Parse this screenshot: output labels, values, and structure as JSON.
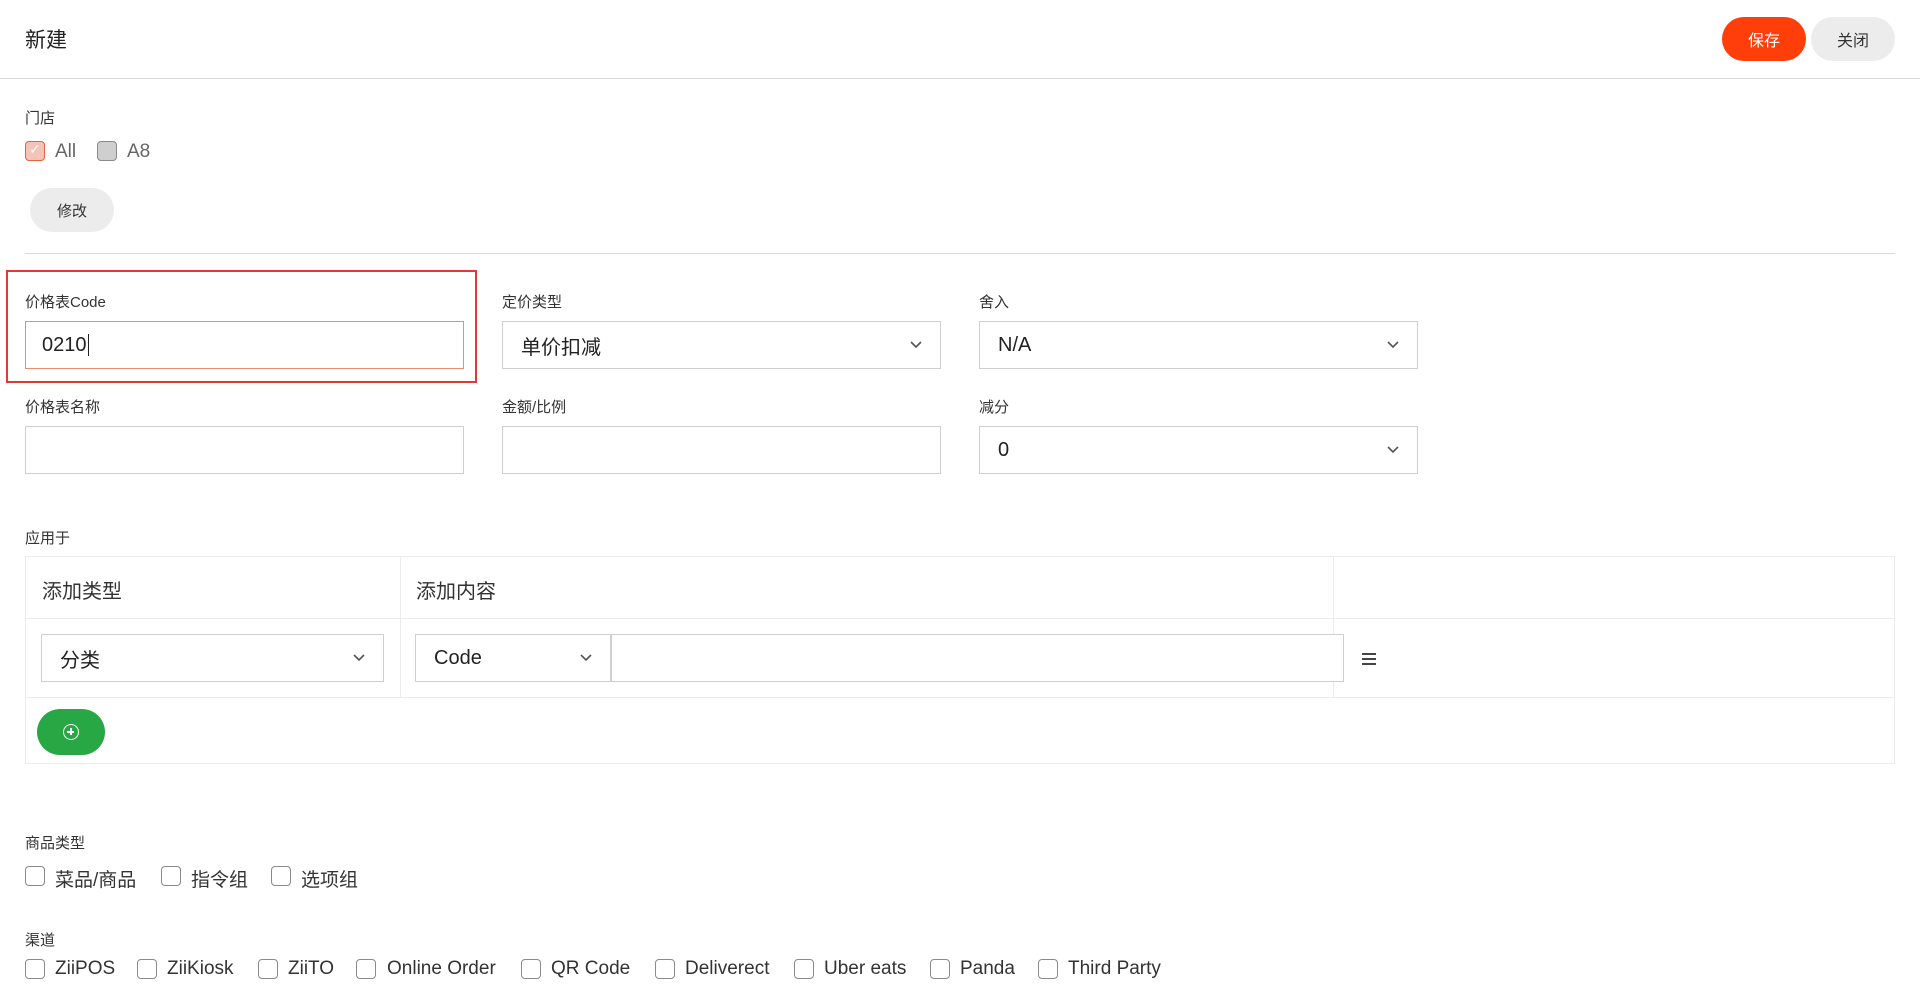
{
  "header": {
    "title": "新建",
    "save_label": "保存",
    "close_label": "关闭"
  },
  "store": {
    "label": "门店",
    "options": [
      {
        "label": "All",
        "checked": true
      },
      {
        "label": "A8",
        "checked": false
      }
    ],
    "modify_label": "修改"
  },
  "form": {
    "code_label": "价格表Code",
    "code_value": "0210",
    "pricing_type_label": "定价类型",
    "pricing_type_value": "单价扣减",
    "rounding_label": "舍入",
    "rounding_value": "N/A",
    "name_label": "价格表名称",
    "name_value": "",
    "amount_label": "金额/比例",
    "amount_value": "",
    "reduce_label": "减分",
    "reduce_value": "0"
  },
  "apply": {
    "label": "应用于",
    "col_type": "添加类型",
    "col_content": "添加内容",
    "row": {
      "type_value": "分类",
      "content_mode": "Code",
      "content_value": ""
    }
  },
  "product_type": {
    "label": "商品类型",
    "options": [
      "菜品/商品",
      "指令组",
      "选项组"
    ]
  },
  "channel": {
    "label": "渠道",
    "options": [
      "ZiiPOS",
      "ZiiKiosk",
      "ZiiTO",
      "Online Order",
      "QR Code",
      "Deliverect",
      "Uber eats",
      "Panda",
      "Third Party"
    ]
  },
  "colors": {
    "accent": "#ff3e0a",
    "add_button": "#28a745",
    "highlight": "#e03b2f"
  }
}
